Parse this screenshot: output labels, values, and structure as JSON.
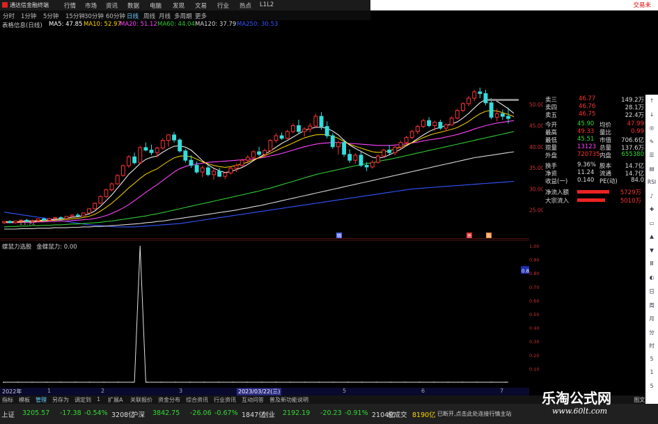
{
  "app": {
    "title": "通达信金融终端",
    "menu": [
      "行情",
      "市场",
      "资讯",
      "数据",
      "电脑",
      "发现",
      "文易",
      "行业",
      "热点",
      "L1L2"
    ],
    "trade_link": "交易未"
  },
  "periods": [
    "分时",
    "1分钟",
    "5分钟",
    "15分钟",
    "30分钟",
    "60分钟",
    "日线",
    "周线",
    "月线",
    "多周期",
    "更多"
  ],
  "active_period": "日线",
  "ma_bar": {
    "label": "表格信息(日线)",
    "items": [
      {
        "text": "MA5: 47.85",
        "color": "#ffffff"
      },
      {
        "text": "MA10: 52.97",
        "color": "#ffd700"
      },
      {
        "text": "MA20: 51.12",
        "color": "#ff44ff"
      },
      {
        "text": "MA60: 44.04",
        "color": "#33cc33"
      },
      {
        "text": "MA120: 37.79",
        "color": "#d8d8d8"
      },
      {
        "text": "MA250: 30.53",
        "color": "#3355ff"
      }
    ]
  },
  "upper_axis": [
    "50.00",
    "45.00",
    "40.00",
    "35.00",
    "30.00",
    "25.00"
  ],
  "upper_marks": {
    "low_label": "21.92",
    "badge1": "明",
    "badge2": "杀",
    "badge3": "购"
  },
  "quote": {
    "rows": [
      {
        "label": "卖三",
        "price": "46.77",
        "vol": "149.2万"
      },
      {
        "label": "卖四",
        "price": "46.76",
        "vol": "28.1万"
      },
      {
        "label": "卖五",
        "price": "46.75",
        "vol": "22.4万"
      }
    ],
    "stats": [
      {
        "k1": "今开",
        "v1": "45.90",
        "k2": "均价",
        "v2": "47.99",
        "c1": "#33dd33",
        "c2": "#ff3333"
      },
      {
        "k1": "最高",
        "v1": "49.33",
        "k2": "量比",
        "v2": "0.99",
        "c1": "#ff3333",
        "c2": "#ff3333"
      },
      {
        "k1": "最低",
        "v1": "45.51",
        "k2": "市值",
        "v2": "706.6亿",
        "c1": "#33dd33",
        "c2": "#dddddd"
      },
      {
        "k1": "现量",
        "v1": "13123",
        "k2": "总量",
        "v2": "137.6万",
        "c1": "#ff44ff",
        "c2": "#dddddd"
      },
      {
        "k1": "外盘",
        "v1": "720735",
        "k2": "内盘",
        "v2": "655380",
        "c1": "#ff3333",
        "c2": "#33dd33"
      }
    ],
    "stats2": [
      {
        "k1": "换手",
        "v1": "9.36%",
        "k2": "股本",
        "v2": "14.7亿"
      },
      {
        "k1": "净资",
        "v1": "11.24",
        "k2": "流通",
        "v2": "14.7亿"
      },
      {
        "k1": "收益(一)",
        "v1": "0.140",
        "k2": "PE(动)",
        "v2": "84.0"
      }
    ],
    "flow": [
      {
        "label": "净流入额",
        "value": "5729万"
      },
      {
        "label": "大宗流入",
        "value": "5010万"
      }
    ]
  },
  "indicator": {
    "name": "蝶鼠力选股",
    "sub": "金蝶鼠力: 0.00",
    "axis": [
      "1.00",
      "0.90",
      "0.80",
      "0.70",
      "0.60",
      "0.50",
      "0.40",
      "0.30",
      "0.20",
      "0.10"
    ],
    "value_tag": "0.82"
  },
  "date_bar": {
    "start": "2022年",
    "selected": "2023/03/22(三)",
    "months": [
      "1",
      "2",
      "3",
      "5",
      "6",
      "7"
    ]
  },
  "bottom_tabs": [
    "指标",
    "模板",
    "管理",
    "另存为",
    "调定到",
    "1",
    "扩展A",
    "关联报价",
    "资金分布",
    "综合资讯",
    "行业资讯",
    "互动问答",
    "普及新功能说明"
  ],
  "bottom_right": "图文F10",
  "ticker": [
    {
      "name": "上证",
      "price": "3205.57",
      "chg": "-17.38",
      "pct": "-0.54%",
      "amt": "3208亿"
    },
    {
      "name": "沪深",
      "price": "3842.75",
      "chg": "-26.06",
      "pct": "-0.67%",
      "amt": "1847亿"
    },
    {
      "name": "创业",
      "price": "2192.19",
      "chg": "-20.23",
      "pct": "-0.91%",
      "amt": "2104亿"
    }
  ],
  "ticker_extra": {
    "label": "总成交",
    "value": "8190亿",
    "status": "已断开,点击此处连接行情主站"
  },
  "watermark": {
    "text": "乐淘公式网",
    "url": "www.60lt.com"
  },
  "right_toolbar": [
    "↑",
    "↓",
    "◎",
    "✎",
    "☰",
    "▤",
    "RSI",
    "♪",
    "✚",
    "▭",
    "▲",
    "▼",
    "Ⅲ",
    "◐",
    "日",
    "周",
    "月",
    "分",
    "时",
    "5",
    "1",
    "5"
  ],
  "chart_data": {
    "type": "candlestick",
    "candles": [
      [
        22.0,
        22.4,
        21.7,
        22.3
      ],
      [
        22.3,
        22.6,
        21.9,
        22.0
      ],
      [
        22.0,
        22.5,
        21.8,
        22.4
      ],
      [
        22.4,
        22.8,
        22.1,
        22.6
      ],
      [
        22.6,
        22.9,
        22.2,
        22.3
      ],
      [
        22.3,
        22.7,
        22.0,
        22.5
      ],
      [
        22.5,
        23.0,
        22.3,
        22.9
      ],
      [
        22.9,
        23.2,
        22.5,
        22.6
      ],
      [
        22.6,
        23.1,
        22.4,
        23.0
      ],
      [
        23.0,
        23.4,
        22.8,
        23.2
      ],
      [
        23.2,
        23.5,
        22.9,
        23.0
      ],
      [
        23.0,
        23.6,
        22.9,
        23.5
      ],
      [
        23.5,
        24.0,
        23.3,
        23.8
      ],
      [
        23.8,
        24.2,
        23.5,
        23.6
      ],
      [
        23.6,
        24.4,
        23.5,
        24.3
      ],
      [
        24.3,
        25.5,
        24.2,
        25.3
      ],
      [
        25.3,
        26.8,
        25.1,
        26.6
      ],
      [
        26.6,
        28.5,
        26.4,
        28.2
      ],
      [
        28.2,
        30.0,
        27.9,
        29.8
      ],
      [
        29.8,
        31.5,
        29.4,
        31.2
      ],
      [
        31.2,
        33.5,
        31.0,
        33.2
      ],
      [
        33.2,
        35.8,
        32.9,
        35.5
      ],
      [
        35.5,
        38.0,
        35.0,
        37.6
      ],
      [
        37.6,
        38.6,
        35.8,
        36.2
      ],
      [
        36.2,
        40.2,
        36.0,
        39.8
      ],
      [
        39.8,
        41.0,
        38.9,
        39.2
      ],
      [
        39.2,
        40.5,
        38.0,
        38.6
      ],
      [
        38.6,
        40.0,
        37.5,
        39.7
      ],
      [
        39.7,
        42.0,
        39.3,
        41.5
      ],
      [
        41.5,
        43.0,
        40.0,
        42.8
      ],
      [
        42.8,
        43.5,
        41.0,
        41.6
      ],
      [
        41.6,
        42.0,
        38.6,
        39.0
      ],
      [
        39.0,
        39.5,
        36.2,
        36.8
      ],
      [
        36.8,
        38.0,
        35.0,
        35.6
      ],
      [
        35.6,
        36.5,
        33.6,
        34.0
      ],
      [
        34.0,
        35.5,
        32.8,
        35.0
      ],
      [
        35.0,
        35.6,
        33.0,
        33.4
      ],
      [
        33.4,
        34.8,
        32.2,
        34.2
      ],
      [
        34.2,
        35.0,
        32.8,
        33.0
      ],
      [
        33.0,
        34.0,
        32.3,
        33.8
      ],
      [
        33.8,
        35.2,
        33.4,
        34.9
      ],
      [
        34.9,
        36.0,
        34.0,
        35.6
      ],
      [
        35.6,
        37.2,
        35.2,
        36.8
      ],
      [
        36.8,
        38.0,
        36.0,
        37.5
      ],
      [
        37.5,
        39.2,
        37.1,
        38.8
      ],
      [
        38.8,
        40.0,
        37.8,
        38.2
      ],
      [
        38.2,
        39.5,
        37.4,
        39.1
      ],
      [
        39.1,
        41.8,
        38.9,
        41.5
      ],
      [
        41.5,
        43.2,
        41.0,
        42.6
      ],
      [
        42.6,
        43.4,
        41.6,
        42.0
      ],
      [
        42.0,
        44.0,
        41.8,
        43.6
      ],
      [
        43.6,
        45.5,
        43.2,
        45.0
      ],
      [
        45.0,
        46.4,
        43.0,
        43.6
      ],
      [
        43.6,
        44.6,
        42.4,
        44.2
      ],
      [
        44.2,
        45.6,
        43.4,
        44.9
      ],
      [
        44.9,
        47.8,
        44.6,
        47.2
      ],
      [
        47.2,
        48.2,
        44.0,
        44.8
      ],
      [
        44.8,
        46.0,
        42.0,
        42.6
      ],
      [
        42.6,
        43.2,
        39.5,
        40.0
      ],
      [
        40.0,
        41.5,
        38.2,
        41.0
      ],
      [
        41.0,
        41.8,
        37.6,
        38.2
      ],
      [
        38.2,
        39.4,
        36.2,
        36.8
      ],
      [
        36.8,
        38.4,
        36.0,
        38.0
      ],
      [
        38.0,
        38.8,
        35.2,
        35.6
      ],
      [
        35.6,
        36.4,
        34.2,
        35.2
      ],
      [
        35.2,
        36.8,
        34.8,
        36.3
      ],
      [
        36.3,
        38.2,
        36.0,
        37.8
      ],
      [
        37.8,
        39.5,
        37.4,
        39.2
      ],
      [
        39.2,
        40.4,
        38.2,
        38.6
      ],
      [
        38.6,
        40.2,
        38.0,
        39.9
      ],
      [
        39.9,
        41.4,
        39.5,
        41.0
      ],
      [
        41.0,
        42.6,
        40.6,
        42.2
      ],
      [
        42.2,
        44.0,
        41.8,
        43.6
      ],
      [
        43.6,
        45.2,
        43.0,
        44.8
      ],
      [
        44.8,
        46.6,
        44.4,
        46.2
      ],
      [
        46.2,
        47.0,
        44.6,
        45.0
      ],
      [
        45.0,
        46.2,
        43.8,
        45.8
      ],
      [
        45.8,
        46.4,
        44.0,
        44.4
      ],
      [
        44.4,
        45.5,
        43.6,
        45.2
      ],
      [
        45.2,
        47.2,
        45.0,
        46.8
      ],
      [
        46.8,
        49.0,
        46.5,
        48.6
      ],
      [
        48.6,
        50.5,
        48.2,
        50.2
      ],
      [
        50.2,
        52.0,
        49.6,
        51.5
      ],
      [
        51.5,
        53.5,
        50.8,
        53.0
      ],
      [
        53.0,
        54.0,
        51.5,
        52.6
      ],
      [
        52.6,
        53.5,
        49.8,
        50.4
      ],
      [
        50.4,
        51.5,
        46.5,
        47.0
      ],
      [
        47.0,
        49.0,
        46.0,
        47.8
      ],
      [
        47.8,
        48.8,
        46.4,
        47.2
      ],
      [
        47.2,
        49.3,
        45.5,
        46.7
      ]
    ],
    "ma": {
      "MA5": [
        22.2,
        22.3,
        22.2,
        22.3,
        22.4,
        22.4,
        22.5,
        22.6,
        22.7,
        22.8,
        22.9,
        23.1,
        23.3,
        23.4,
        23.7,
        24.1,
        24.8,
        25.9,
        27.2,
        28.6,
        30.2,
        31.8,
        33.5,
        34.7,
        36.0,
        37.0,
        37.5,
        37.8,
        38.7,
        39.5,
        40.1,
        40.2,
        39.9,
        39.2,
        38.0,
        36.7,
        35.7,
        34.9,
        34.3,
        33.9,
        34.1,
        34.6,
        35.1,
        35.8,
        36.7,
        37.5,
        38.2,
        39.0,
        39.9,
        40.8,
        41.5,
        42.3,
        43.1,
        43.8,
        44.3,
        44.6,
        44.6,
        44.4,
        43.7,
        42.8,
        41.5,
        40.4,
        39.6,
        38.9,
        38.2,
        37.5,
        37.3,
        37.5,
        38.1,
        38.7,
        39.4,
        40.2,
        41.0,
        41.9,
        42.8,
        43.6,
        44.2,
        44.6,
        45.0,
        45.4,
        45.9,
        46.8,
        47.9,
        49.2,
        50.4,
        51.2,
        51.3,
        50.8,
        49.9,
        49.0,
        47.9
      ],
      "MA20": [
        22.0,
        22.0,
        22.0,
        22.1,
        22.1,
        22.1,
        22.2,
        22.2,
        22.3,
        22.3,
        22.4,
        22.4,
        22.5,
        22.6,
        22.7,
        22.8,
        23.0,
        23.3,
        23.7,
        24.2,
        24.8,
        25.5,
        26.3,
        27.2,
        28.2,
        29.2,
        30.1,
        31.0,
        32.0,
        33.0,
        34.0,
        34.8,
        35.3,
        35.7,
        35.9,
        36.1,
        36.3,
        36.4,
        36.5,
        36.6,
        36.7,
        36.8,
        36.9,
        37.0,
        37.1,
        37.3,
        37.5,
        37.8,
        38.1,
        38.4,
        38.8,
        39.2,
        39.6,
        40.0,
        40.3,
        40.6,
        40.8,
        40.9,
        41.0,
        41.0,
        40.9,
        40.8,
        40.7,
        40.6,
        40.5,
        40.4,
        40.3,
        40.3,
        40.3,
        40.4,
        40.5,
        40.7,
        40.9,
        41.1,
        41.4,
        41.6,
        41.8,
        42.0,
        42.3,
        42.6,
        42.9,
        43.3,
        43.7,
        44.2,
        44.6,
        45.0,
        45.3,
        45.6,
        45.8,
        46.0,
        46.2
      ],
      "MA60": [
        21.0,
        21.1,
        21.1,
        21.2,
        21.2,
        21.3,
        21.3,
        21.4,
        21.4,
        21.5,
        21.5,
        21.6,
        21.7,
        21.7,
        21.8,
        21.9,
        22.0,
        22.1,
        22.3,
        22.4,
        22.6,
        22.8,
        23.0,
        23.2,
        23.4,
        23.6,
        23.9,
        24.1,
        24.4,
        24.7,
        25.0,
        25.3,
        25.6,
        25.9,
        26.2,
        26.5,
        26.8,
        27.1,
        27.4,
        27.7,
        28.0,
        28.3,
        28.6,
        28.9,
        29.2,
        29.5,
        29.9,
        30.2,
        30.6,
        31.0,
        31.4,
        31.8,
        32.2,
        32.6,
        33.0,
        33.4,
        33.7,
        34.0,
        34.3,
        34.6,
        34.9,
        35.2,
        35.5,
        35.7,
        36.0,
        36.2,
        36.5,
        36.8,
        37.0,
        37.3,
        37.6,
        37.9,
        38.2,
        38.5,
        38.8,
        39.1,
        39.4,
        39.7,
        40.0,
        40.3,
        40.6,
        40.9,
        41.2,
        41.5,
        41.8,
        42.1,
        42.4,
        42.7,
        43.0,
        43.3,
        43.6
      ],
      "MA120": [
        20.5,
        20.5,
        20.5,
        20.6,
        20.6,
        20.6,
        20.7,
        20.7,
        20.7,
        20.8,
        20.8,
        20.8,
        20.9,
        20.9,
        21.0,
        21.0,
        21.1,
        21.1,
        21.2,
        21.3,
        21.4,
        21.5,
        21.6,
        21.7,
        21.8,
        22.0,
        22.1,
        22.3,
        22.4,
        22.6,
        22.8,
        23.0,
        23.2,
        23.4,
        23.6,
        23.8,
        24.0,
        24.2,
        24.4,
        24.6,
        24.8,
        25.0,
        25.3,
        25.5,
        25.8,
        26.0,
        26.3,
        26.6,
        26.9,
        27.2,
        27.5,
        27.8,
        28.1,
        28.4,
        28.7,
        29.0,
        29.3,
        29.6,
        29.9,
        30.2,
        30.5,
        30.8,
        31.1,
        31.4,
        31.7,
        32.0,
        32.3,
        32.6,
        32.9,
        33.2,
        33.5,
        33.8,
        34.1,
        34.4,
        34.7,
        35.0,
        35.3,
        35.6,
        35.9,
        36.2,
        36.5,
        36.8,
        37.1,
        37.4,
        37.6,
        37.8,
        38.0,
        38.2,
        38.4,
        38.6,
        38.8
      ],
      "MA250": [
        24.5,
        24.3,
        24.1,
        23.9,
        23.7,
        23.5,
        23.3,
        23.1,
        22.9,
        22.7,
        22.5,
        22.3,
        22.1,
        21.9,
        21.7,
        21.5,
        21.4,
        21.3,
        21.2,
        21.1,
        21.0,
        21.0,
        21.0,
        21.0,
        21.1,
        21.2,
        21.3,
        21.4,
        21.5,
        21.6,
        21.7,
        21.8,
        22.0,
        22.2,
        22.4,
        22.6,
        22.8,
        23.0,
        23.2,
        23.4,
        23.6,
        23.8,
        24.0,
        24.2,
        24.4,
        24.6,
        24.8,
        25.0,
        25.2,
        25.4,
        25.6,
        25.8,
        26.0,
        26.2,
        26.4,
        26.6,
        26.8,
        27.0,
        27.2,
        27.4,
        27.6,
        27.8,
        28.0,
        28.2,
        28.4,
        28.6,
        28.8,
        29.0,
        29.2,
        29.4,
        29.6,
        29.8,
        30.0,
        30.1,
        30.2,
        30.3,
        30.4,
        30.5,
        30.6,
        30.7,
        30.8,
        30.9,
        31.0,
        31.1,
        31.2,
        31.3,
        31.4,
        31.5,
        31.6,
        31.7,
        31.8
      ]
    },
    "ma_colors": {
      "MA5": "#ffffff",
      "MA10": "#ffd700",
      "MA20": "#ff44ff",
      "MA60": "#33cc33",
      "MA120": "#d8d8d8",
      "MA250": "#3355ff"
    },
    "ylim": [
      20,
      52
    ],
    "indicator_series": {
      "spike_index": 24,
      "spike_value": 1.0,
      "baseline": 0.0
    }
  }
}
